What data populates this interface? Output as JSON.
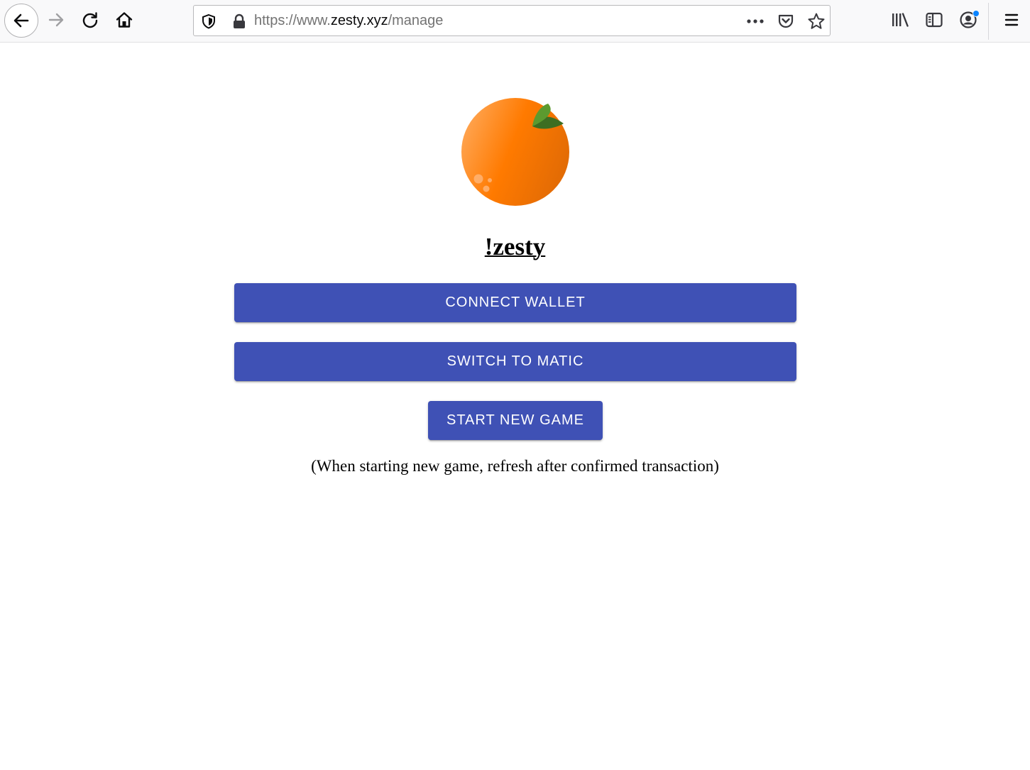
{
  "browser": {
    "url_prefix": "https://www.",
    "url_domain": "zesty.xyz",
    "url_path": "/manage",
    "accent_dot_color": "#0a84ff"
  },
  "icons": {
    "back": "back-arrow-icon",
    "forward": "forward-arrow-icon",
    "reload": "reload-icon",
    "home": "home-icon",
    "shield": "tracking-protection-shield-icon",
    "lock": "lock-icon",
    "more": "more-actions-icon",
    "pocket": "pocket-icon",
    "star": "bookmark-star-icon",
    "library": "library-icon",
    "sidebar": "sidebar-icon",
    "account": "account-icon",
    "menu": "hamburger-menu-icon"
  },
  "page": {
    "title": "!zesty",
    "buttons": {
      "connect": "CONNECT WALLET",
      "switch": "SWITCH TO MATIC",
      "start": "START NEW GAME"
    },
    "note": "(When starting new game, refresh after confirmed transaction)",
    "button_color": "#3f51b5"
  }
}
